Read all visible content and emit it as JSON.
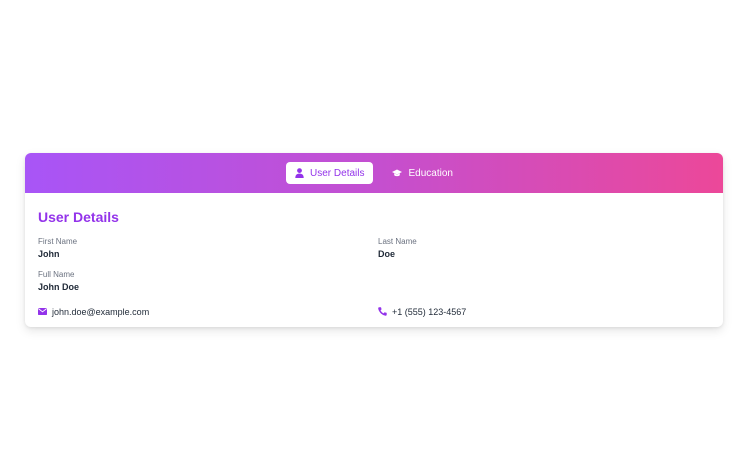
{
  "tabs": [
    {
      "label": "User Details",
      "icon": "user-icon",
      "active": true
    },
    {
      "label": "Education",
      "icon": "graduation-cap-icon",
      "active": false
    }
  ],
  "section": {
    "title": "User Details"
  },
  "fields": {
    "first_name": {
      "label": "First Name",
      "value": "John"
    },
    "last_name": {
      "label": "Last Name",
      "value": "Doe"
    },
    "full_name": {
      "label": "Full Name",
      "value": "John Doe"
    }
  },
  "contact": {
    "email": "john.doe@example.com",
    "email_icon": "envelope-icon",
    "phone": "+1 (555) 123-4567",
    "phone_icon": "phone-icon"
  },
  "colors": {
    "accent": "#9333ea",
    "gradient_start": "#a855f7",
    "gradient_end": "#ec4899"
  }
}
